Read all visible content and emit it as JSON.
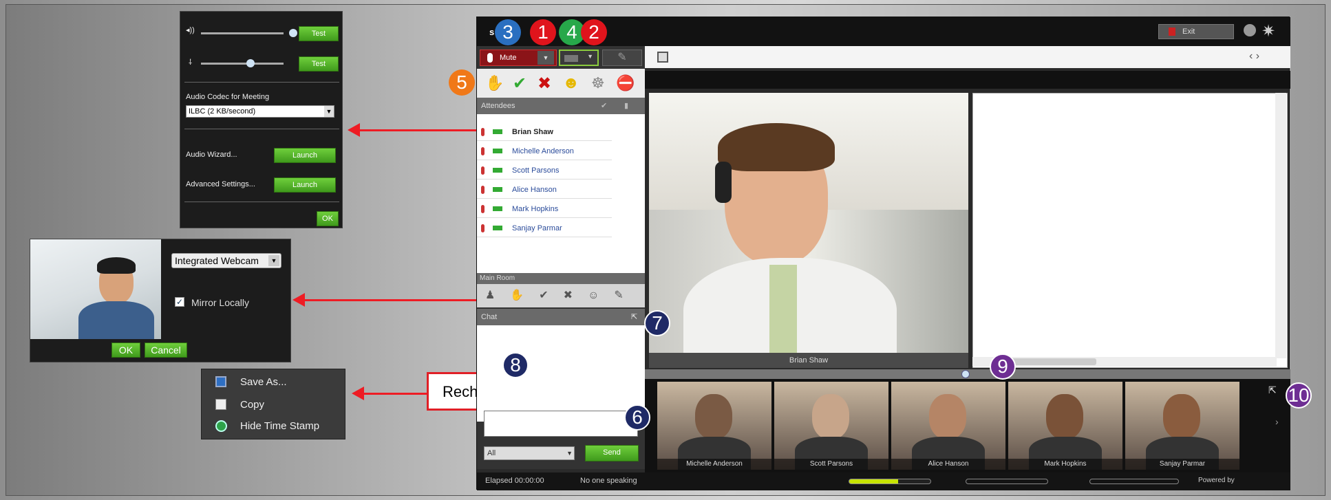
{
  "audio_panel": {
    "test1": "Test",
    "test2": "Test",
    "codec_label": "Audio Codec for Meeting",
    "codec_value": "ILBC (2 KB/second)",
    "wizard_label": "Audio Wizard...",
    "wizard_btn": "Launch",
    "adv_label": "Advanced Settings...",
    "adv_btn": "Launch",
    "ok": "OK"
  },
  "cam_panel": {
    "device": "Integrated Webcam",
    "mirror": "Mirror Locally",
    "ok": "OK",
    "cancel": "Cancel"
  },
  "context_menu": {
    "items": [
      "Save As...",
      "Copy",
      "Hide Time Stamp"
    ]
  },
  "callout": {
    "label": "Rechts-Klick"
  },
  "badges": {
    "b1": "1",
    "b2": "2",
    "b3": "3",
    "b4": "4",
    "b5": "5",
    "b6": "6",
    "b7": "7",
    "b8": "8",
    "b9": "9",
    "b10": "10"
  },
  "app": {
    "mute": "Mute",
    "exit": "Exit",
    "attendees": "Attendees",
    "attendee_list": [
      "Brian Shaw",
      "Michelle Anderson",
      "Scott Parsons",
      "Alice Hanson",
      "Mark Hopkins",
      "Sanjay Parmar"
    ],
    "main_room": "Main Room",
    "chat": "Chat",
    "chat_target": "All",
    "send": "Send",
    "main_video_name": "Brian Shaw",
    "elapsed": "Elapsed 00:00:00",
    "speaking": "No one speaking",
    "powered": "Powered by"
  },
  "thumbs": [
    "Michelle Anderson",
    "Scott Parsons",
    "Alice Hanson",
    "Mark Hopkins",
    "Sanjay Parmar"
  ]
}
